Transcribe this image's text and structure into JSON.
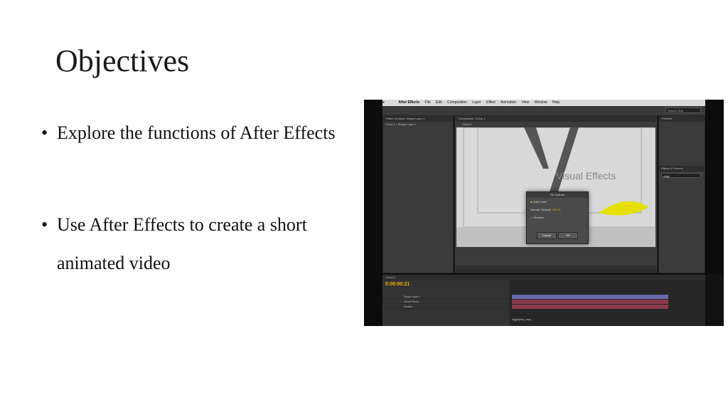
{
  "slide": {
    "title": "Objectives",
    "bullets": [
      {
        "text": "Explore the functions of After Effects"
      },
      {
        "text": "Use After Effects to create a short animated video"
      }
    ],
    "bullet_char": "•"
  },
  "screenshot": {
    "menubar": {
      "app": "After Effects",
      "items": [
        "File",
        "Edit",
        "Composition",
        "Layer",
        "Effect",
        "Animation",
        "View",
        "Window",
        "Help"
      ]
    },
    "search_placeholder": "Search Help",
    "left_panel": {
      "tab": "Effect Controls: Shape Layer 1",
      "subtab": "Comp 1 • Shape Layer 1"
    },
    "comp_panel": {
      "tab": "Composition: Comp 1",
      "subtab": "Comp 1"
    },
    "viewer_text": "Visual Effects",
    "dialog": {
      "title": "Fill Options",
      "fill_label": "Solid Color",
      "mode": "Normal",
      "opacity_label": "Opacity:",
      "opacity_value": "100 %",
      "preview": "Preview",
      "cancel": "Cancel",
      "ok": "OK"
    },
    "right_panel": {
      "tab": "Preview",
      "effects_tab": "Effects & Presets",
      "search": "wiggl"
    },
    "timeline": {
      "timecode": "0:00:00:21",
      "tab": "Comp 1",
      "rows": [
        "Shape Layer 1",
        "Visual Effects",
        "Position"
      ],
      "expression": "wiggle(freq, amp)"
    },
    "colors": {
      "accent": "#f5b800",
      "bar1": "#6a6bb0",
      "bar2": "#8a3a4a"
    }
  }
}
